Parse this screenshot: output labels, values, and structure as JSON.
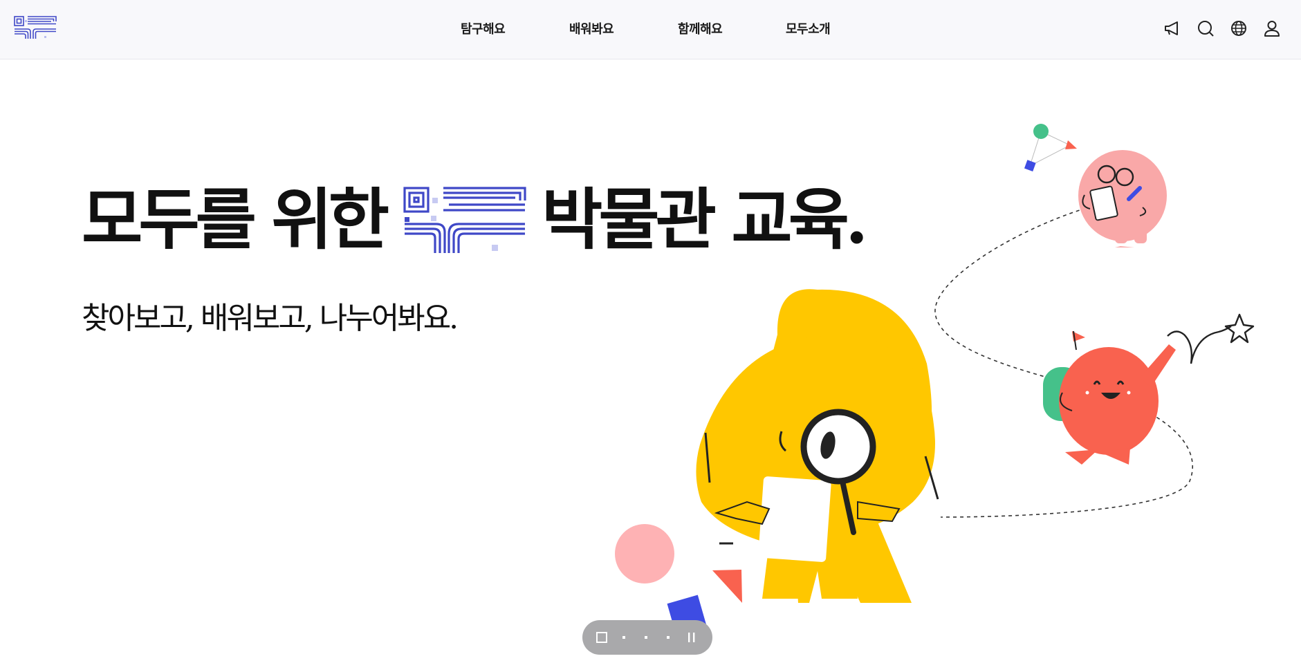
{
  "header": {
    "nav": [
      {
        "label": "탐구해요"
      },
      {
        "label": "배워봐요"
      },
      {
        "label": "함께해요"
      },
      {
        "label": "모두소개"
      }
    ],
    "utilities": [
      {
        "icon": "megaphone-icon"
      },
      {
        "icon": "search-icon"
      },
      {
        "icon": "globe-icon"
      },
      {
        "icon": "user-icon"
      }
    ]
  },
  "hero": {
    "title_before": "모두를 위한",
    "title_after": "박물관 교육.",
    "subtitle": "찾아보고, 배워보고, 나누어봐요."
  },
  "slider": {
    "total_slides": 4,
    "active_slide": 1
  },
  "colors": {
    "brand_blue": "#3f48c7",
    "yellow": "#ffc700",
    "coral": "#f9624f",
    "pink": "#f9a8a8",
    "green": "#45c18a",
    "square_blue": "#3e4ce3"
  }
}
